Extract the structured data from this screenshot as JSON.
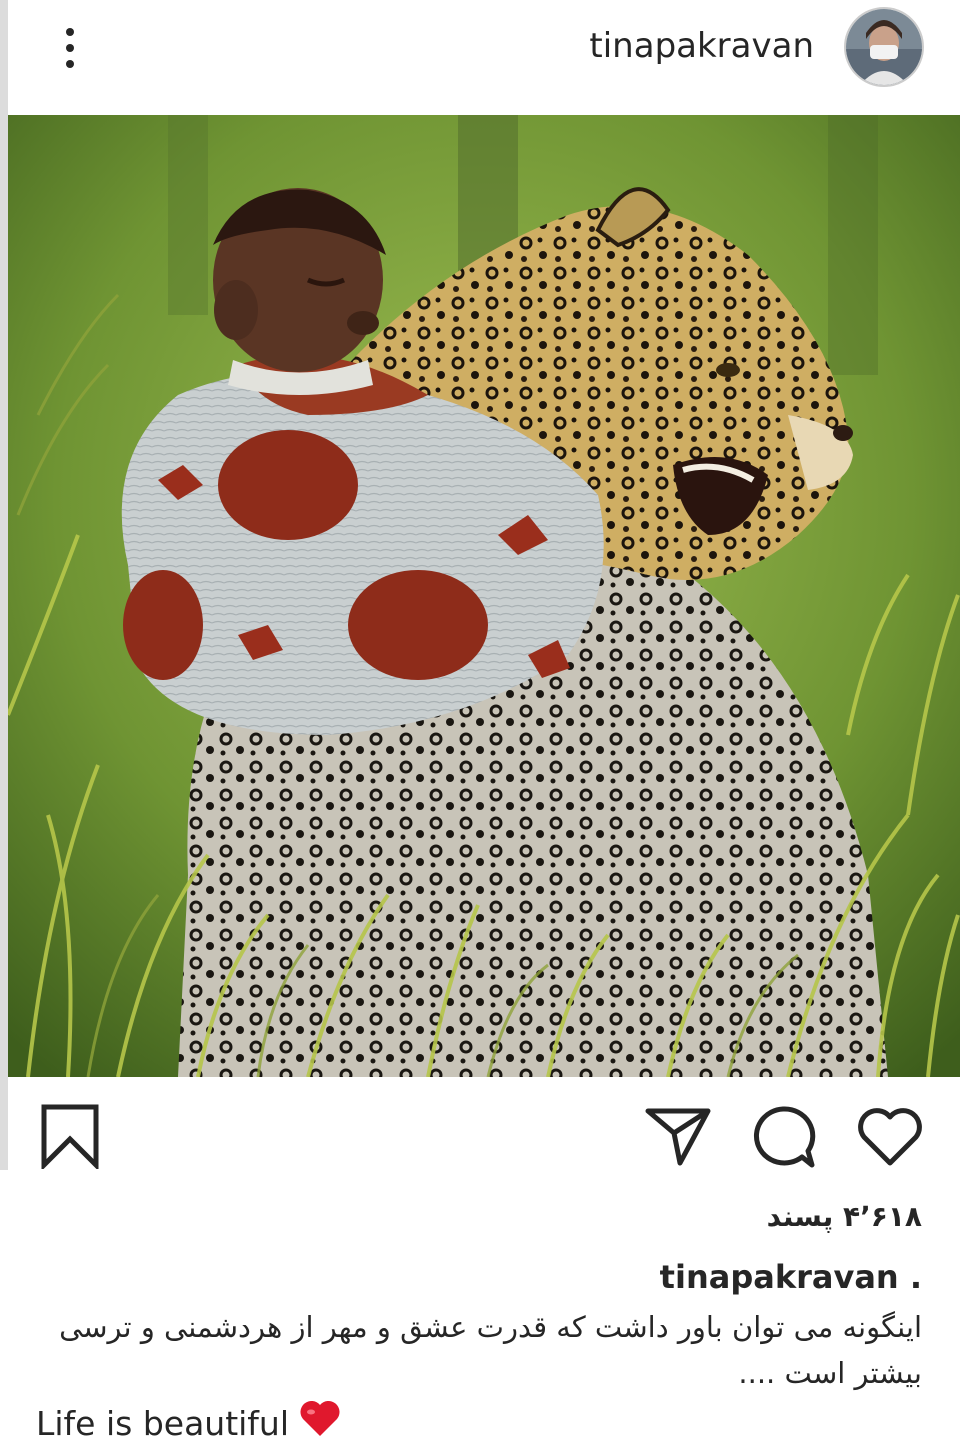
{
  "post": {
    "username": "tinapakravan",
    "likes_text": "۴٬۶۱۸ پسند",
    "caption_user": "tinapakravan .",
    "caption_text": "اینگونه می توان باور داشت که قدرت عشق و مهر از هردشمنی و ترسی بیشتر است ....",
    "tagline": "Life is beautiful",
    "tagline_emoji": "red-heart-icon"
  },
  "icons": {
    "more": "more-vertical-icon",
    "save": "bookmark-icon",
    "share": "send-icon",
    "comment": "comment-icon",
    "like": "heart-icon"
  },
  "colors": {
    "text": "#262626",
    "heart_emoji": "#e0182d",
    "grass": "#7aa23a",
    "leopard_fur": "#c9a55a",
    "sling_print": "#9a2e1c"
  }
}
